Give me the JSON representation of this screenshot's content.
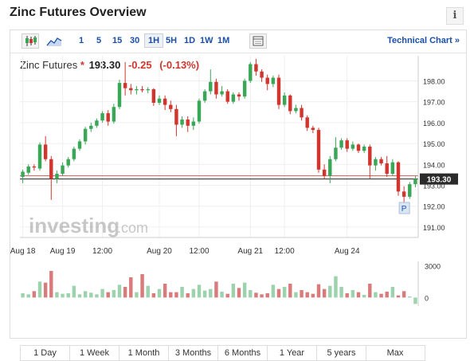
{
  "header": {
    "title": "Zinc Futures Overview",
    "info_glyph": "i"
  },
  "toolbar": {
    "timeframes": [
      "1",
      "5",
      "15",
      "30",
      "1H",
      "5H",
      "1D",
      "1W",
      "1M"
    ],
    "active_timeframe": "1H",
    "tech_link": "Technical Chart »",
    "icons": [
      "candlestick-icon",
      "area-chart-icon",
      "calendar-icon"
    ]
  },
  "quote": {
    "name": "Zinc Futures",
    "star": "*",
    "price": "193.30",
    "change": "-0.25",
    "change_pct": "(-0.13%)"
  },
  "watermark": {
    "brand": "investing",
    "suffix": ".com"
  },
  "colors": {
    "up": "#3aa757",
    "down": "#d0362e",
    "vol_up": "#9cd2ac",
    "vol_down": "#d97b7b",
    "link": "#1a4ea8"
  },
  "chart_data": {
    "type": "candlestick",
    "title": "",
    "ylim": [
      190.5,
      199.2
    ],
    "yticks": [
      "198.00",
      "197.00",
      "196.00",
      "195.00",
      "194.00",
      "193.00",
      "192.00",
      "191.00"
    ],
    "y_tick_values": [
      198,
      197,
      196,
      195,
      194,
      193,
      192,
      191
    ],
    "x_labels": [
      "Aug 18",
      "Aug 19",
      "12:00",
      "Aug 20",
      "12:00",
      "Aug 21",
      "12:00",
      "Aug 24"
    ],
    "x_label_index": [
      0,
      7,
      14,
      24,
      31,
      40,
      46,
      57
    ],
    "last_price": "193.30",
    "last_value": 193.3,
    "candles": [
      [
        193.4,
        193.65,
        193.1,
        193.75
      ],
      [
        193.6,
        193.9,
        193.5,
        194.0
      ],
      [
        193.9,
        193.85,
        193.7,
        194.0
      ],
      [
        193.8,
        194.95,
        193.7,
        195.05
      ],
      [
        194.95,
        194.25,
        194.15,
        195.35
      ],
      [
        194.25,
        193.3,
        192.3,
        194.4
      ],
      [
        193.3,
        193.55,
        193.1,
        193.7
      ],
      [
        193.55,
        193.95,
        193.45,
        194.1
      ],
      [
        193.95,
        194.25,
        193.85,
        194.35
      ],
      [
        194.25,
        194.75,
        194.15,
        194.85
      ],
      [
        194.75,
        195.1,
        194.65,
        195.2
      ],
      [
        195.1,
        195.7,
        194.95,
        195.8
      ],
      [
        195.7,
        195.85,
        195.55,
        196.0
      ],
      [
        195.85,
        196.1,
        195.75,
        196.2
      ],
      [
        196.1,
        196.45,
        196.0,
        196.55
      ],
      [
        196.45,
        196.05,
        195.85,
        196.6
      ],
      [
        196.05,
        196.75,
        195.95,
        196.9
      ],
      [
        196.75,
        197.9,
        196.65,
        198.05
      ],
      [
        197.9,
        197.65,
        197.3,
        198.9
      ],
      [
        197.65,
        197.55,
        197.35,
        197.85
      ],
      [
        197.55,
        197.6,
        197.35,
        197.75
      ],
      [
        197.6,
        197.55,
        197.45,
        197.75
      ],
      [
        197.55,
        197.6,
        197.4,
        197.7
      ],
      [
        197.6,
        196.95,
        196.8,
        197.65
      ],
      [
        196.95,
        197.15,
        196.85,
        197.3
      ],
      [
        197.15,
        196.85,
        196.6,
        197.3
      ],
      [
        196.85,
        196.65,
        196.5,
        197.05
      ],
      [
        196.65,
        195.9,
        195.35,
        196.85
      ],
      [
        195.9,
        196.15,
        195.75,
        196.3
      ],
      [
        196.15,
        195.85,
        195.55,
        196.3
      ],
      [
        195.85,
        196.05,
        195.65,
        196.25
      ],
      [
        196.05,
        197.05,
        195.95,
        197.15
      ],
      [
        197.05,
        197.5,
        196.95,
        197.6
      ],
      [
        197.5,
        197.95,
        197.35,
        198.55
      ],
      [
        197.95,
        197.35,
        197.15,
        198.1
      ],
      [
        197.35,
        197.5,
        197.25,
        197.75
      ],
      [
        197.5,
        197.0,
        196.9,
        197.6
      ],
      [
        197.0,
        197.35,
        196.9,
        197.45
      ],
      [
        197.35,
        197.25,
        197.05,
        197.45
      ],
      [
        197.25,
        198.0,
        197.15,
        198.1
      ],
      [
        198.0,
        198.8,
        197.9,
        198.9
      ],
      [
        198.8,
        198.45,
        198.25,
        199.05
      ],
      [
        198.45,
        198.15,
        197.95,
        198.55
      ],
      [
        198.15,
        197.85,
        197.55,
        198.3
      ],
      [
        197.85,
        198.15,
        197.7,
        198.25
      ],
      [
        198.15,
        196.85,
        196.65,
        198.3
      ],
      [
        196.85,
        197.3,
        196.75,
        197.45
      ],
      [
        197.3,
        196.55,
        196.4,
        197.35
      ],
      [
        196.55,
        196.7,
        196.45,
        196.85
      ],
      [
        196.7,
        196.25,
        196.1,
        196.85
      ],
      [
        196.25,
        195.75,
        195.6,
        196.35
      ],
      [
        195.75,
        195.65,
        195.5,
        195.85
      ],
      [
        195.65,
        193.75,
        193.6,
        195.75
      ],
      [
        193.75,
        193.45,
        193.3,
        194.0
      ],
      [
        193.45,
        194.25,
        193.1,
        194.4
      ],
      [
        194.25,
        194.8,
        194.15,
        195.3
      ],
      [
        194.8,
        195.15,
        194.7,
        195.25
      ],
      [
        195.15,
        194.75,
        194.6,
        195.25
      ],
      [
        194.75,
        194.95,
        194.65,
        195.1
      ],
      [
        194.95,
        194.65,
        194.55,
        195.0
      ],
      [
        194.65,
        194.85,
        194.55,
        194.95
      ],
      [
        194.85,
        193.95,
        193.3,
        194.95
      ],
      [
        193.95,
        194.25,
        193.7,
        194.35
      ],
      [
        194.25,
        194.05,
        193.95,
        194.35
      ],
      [
        194.05,
        193.55,
        193.4,
        194.4
      ],
      [
        193.55,
        194.1,
        193.45,
        194.25
      ],
      [
        194.1,
        192.7,
        192.5,
        194.15
      ],
      [
        192.7,
        192.45,
        192.1,
        192.95
      ],
      [
        192.45,
        193.05,
        192.35,
        193.15
      ],
      [
        193.05,
        193.3,
        192.9,
        193.45
      ]
    ],
    "volume_ticks": [
      "3000",
      "0"
    ],
    "volume_tick_values": [
      3000,
      0
    ],
    "volume_ylim": [
      -800,
      3400
    ],
    "volume": [
      400,
      300,
      600,
      1500,
      1400,
      2500,
      500,
      350,
      400,
      1100,
      300,
      600,
      450,
      300,
      800,
      500,
      700,
      1200,
      1000,
      1900,
      500,
      2200,
      1100,
      400,
      800,
      1300,
      500,
      500,
      1000,
      400,
      800,
      1200,
      650,
      800,
      1500,
      550,
      350,
      1300,
      900,
      1400,
      700,
      450,
      300,
      400,
      1200,
      800,
      1000,
      1300,
      500,
      700,
      500,
      350,
      1250,
      800,
      1100,
      2000,
      1000,
      400,
      700,
      500,
      250,
      1300,
      500,
      350,
      550,
      1000,
      200,
      600,
      100,
      -600
    ]
  },
  "range_buttons": [
    "1 Day",
    "1 Week",
    "1 Month",
    "3 Months",
    "6 Months",
    "1 Year",
    "5 years",
    "Max"
  ],
  "p_marker": "P"
}
